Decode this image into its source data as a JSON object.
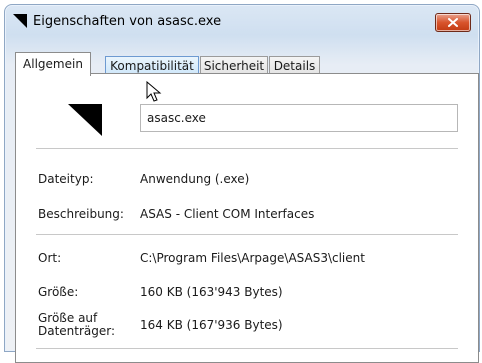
{
  "window": {
    "title": "Eigenschaften von asasc.exe"
  },
  "tabs": [
    {
      "label": "Allgemein"
    },
    {
      "label": "Kompatibilität"
    },
    {
      "label": "Sicherheit"
    },
    {
      "label": "Details"
    }
  ],
  "general": {
    "filename": "asasc.exe",
    "rows": [
      {
        "label": "Dateityp:",
        "value": "Anwendung (.exe)"
      },
      {
        "label": "Beschreibung:",
        "value": "ASAS - Client COM Interfaces"
      },
      {
        "label": "Ort:",
        "value": "C:\\Program Files\\Arpage\\ASAS3\\client"
      },
      {
        "label": "Größe:",
        "value": "160 KB (163'943 Bytes)"
      },
      {
        "label": "Größe auf Datenträger:",
        "value": "164 KB (167'936 Bytes)"
      }
    ]
  },
  "colors": {
    "close_button": "#d8542c",
    "tab_hover": "#cfe7fa",
    "accent_border": "#8fa7c4"
  },
  "icons": {
    "title": "application-icon",
    "close": "close-x-icon",
    "file": "application-file-icon",
    "cursor": "mouse-pointer-icon"
  }
}
